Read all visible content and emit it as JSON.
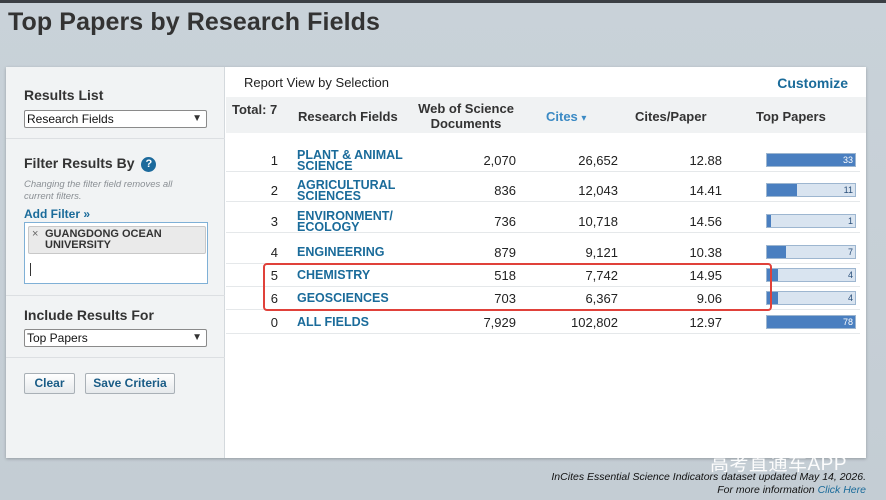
{
  "page": {
    "title": "Top Papers by Research Fields"
  },
  "sidebar": {
    "results_list": {
      "heading": "Results List",
      "selected": "Research Fields"
    },
    "filter": {
      "heading": "Filter Results By",
      "help": "?",
      "note": "Changing the filter field removes all current filters.",
      "add_filter": "Add Filter »",
      "chip_remove": "×",
      "chip": "GUANGDONG OCEAN UNIVERSITY"
    },
    "include": {
      "heading": "Include Results For",
      "selected": "Top Papers"
    },
    "buttons": {
      "clear": "Clear",
      "save": "Save Criteria"
    }
  },
  "report": {
    "label": "Report View by Selection",
    "customize": "Customize",
    "headers": {
      "total": "Total: 7",
      "field": "Research Fields",
      "docs_line1": "Web of Science",
      "docs_line2": "Documents",
      "cites": "Cites",
      "cites_sort": "▾",
      "cites_per_paper": "Cites/Paper",
      "top_papers": "Top Papers"
    },
    "rows": [
      {
        "rank": "1",
        "field_l1": "PLANT & ANIMAL",
        "field_l2": "SCIENCE",
        "docs": "2,070",
        "cites": "26,652",
        "cpp": "12.88",
        "top": "33",
        "fill": 1.0
      },
      {
        "rank": "2",
        "field_l1": "AGRICULTURAL",
        "field_l2": "SCIENCES",
        "docs": "836",
        "cites": "12,043",
        "cpp": "14.41",
        "top": "11",
        "fill": 0.34
      },
      {
        "rank": "3",
        "field_l1": "ENVIRONMENT/",
        "field_l2": "ECOLOGY",
        "docs": "736",
        "cites": "10,718",
        "cpp": "14.56",
        "top": "1",
        "fill": 0.04
      },
      {
        "rank": "4",
        "field_l1": "ENGINEERING",
        "field_l2": "",
        "docs": "879",
        "cites": "9,121",
        "cpp": "10.38",
        "top": "7",
        "fill": 0.22
      },
      {
        "rank": "5",
        "field_l1": "CHEMISTRY",
        "field_l2": "",
        "docs": "518",
        "cites": "7,742",
        "cpp": "14.95",
        "top": "4",
        "fill": 0.13
      },
      {
        "rank": "6",
        "field_l1": "GEOSCIENCES",
        "field_l2": "",
        "docs": "703",
        "cites": "6,367",
        "cpp": "9.06",
        "top": "4",
        "fill": 0.13
      },
      {
        "rank": "0",
        "field_l1": "ALL FIELDS",
        "field_l2": "",
        "docs": "7,929",
        "cites": "102,802",
        "cpp": "12.97",
        "top": "78",
        "fill": 1.0
      }
    ]
  },
  "footer": {
    "watermark": "高考直通车APP",
    "line1": "InCites Essential Science Indicators dataset updated May 14, 2026.",
    "line2_prefix": "For more information",
    "line2_link": "Click Here"
  }
}
